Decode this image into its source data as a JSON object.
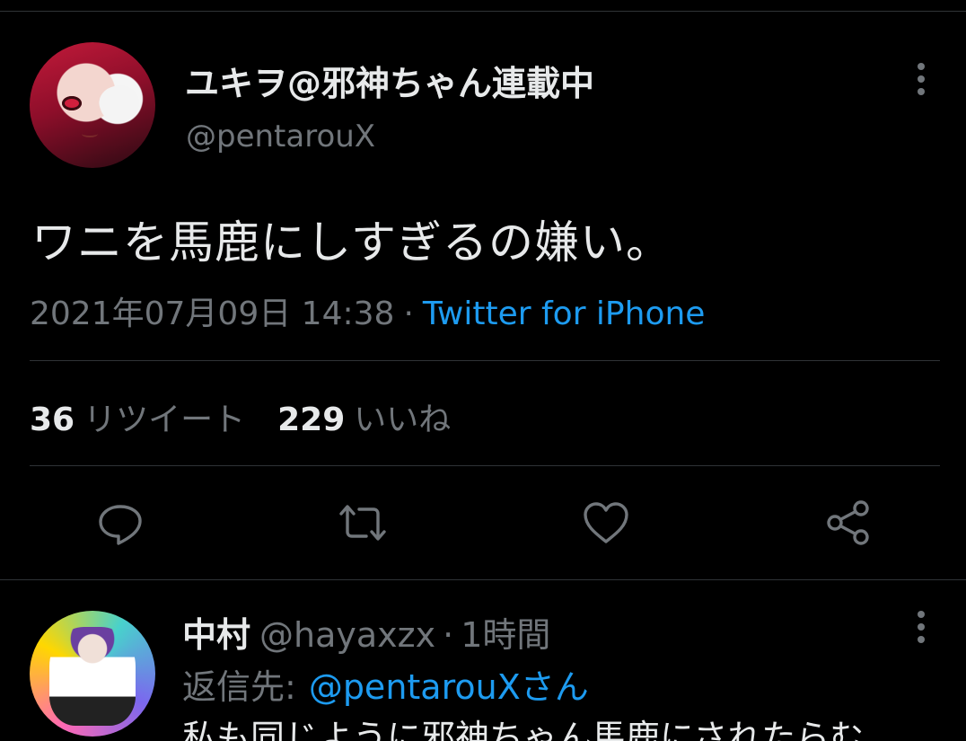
{
  "colors": {
    "background": "#000000",
    "text_primary": "#e7e9ea",
    "text_secondary": "#71767b",
    "link": "#1d9bf0",
    "divider": "#2f3336"
  },
  "tweet": {
    "display_name": "ユキヲ@邪神ちゃん連載中",
    "handle": "@pentarouX",
    "text": "ワニを馬鹿にしすぎるの嫌い。",
    "timestamp": "2021年07月09日 14:38",
    "separator": "·",
    "source": "Twitter for iPhone",
    "retweet_count": "36",
    "retweet_label": "リツイート",
    "like_count": "229",
    "like_label": "いいね",
    "actions": [
      "reply-icon",
      "retweet-icon",
      "like-icon",
      "share-icon"
    ],
    "more_icon": "more-vertical-icon"
  },
  "reply": {
    "display_name": "中村",
    "handle": "@hayaxzx",
    "separator": "·",
    "time": "1時間",
    "reply_prefix": "返信先:",
    "reply_mention": "@pentarouXさん",
    "text": "私も同じように邪神ちゃん馬鹿にされたらむ",
    "more_icon": "more-vertical-icon"
  }
}
